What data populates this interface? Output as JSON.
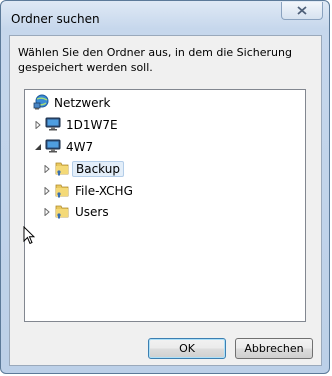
{
  "window": {
    "title": "Ordner suchen"
  },
  "description": "Wählen Sie den Ordner aus, in dem die Sicherung gespeichert werden soll.",
  "tree": {
    "items": [
      {
        "label": "Netzwerk",
        "icon": "network-icon"
      },
      {
        "label": "1D1W7E",
        "icon": "computer-icon",
        "expander": "collapsed"
      },
      {
        "label": "4W7",
        "icon": "computer-icon",
        "expander": "expanded"
      },
      {
        "label": "Backup",
        "icon": "shared-folder-icon",
        "expander": "collapsed",
        "selected": true
      },
      {
        "label": "File-XCHG",
        "icon": "shared-folder-icon",
        "expander": "collapsed"
      },
      {
        "label": "Users",
        "icon": "shared-folder-icon",
        "expander": "collapsed"
      }
    ]
  },
  "buttons": {
    "ok": "OK",
    "cancel": "Abbrechen"
  },
  "colors": {
    "accent": "#3c7fb1",
    "selection": "#e3eef9"
  }
}
